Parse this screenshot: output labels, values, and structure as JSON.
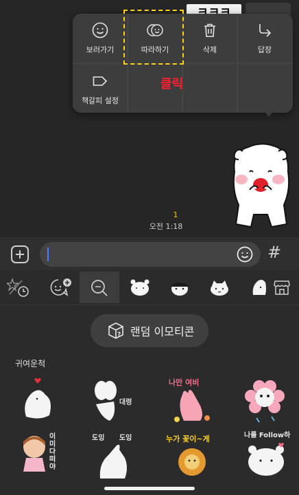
{
  "chat": {
    "peek_text": "ㅋㅋㅋ",
    "read_count": "1",
    "time": "오전 1:18"
  },
  "menu": {
    "items": [
      {
        "label": "보러가기",
        "icon": "smiley-icon"
      },
      {
        "label": "따라하기",
        "icon": "double-smiley-icon"
      },
      {
        "label": "삭제",
        "icon": "trash-icon"
      },
      {
        "label": "답장",
        "icon": "reply-arrow-icon"
      },
      {
        "label": "책갈피 설정",
        "icon": "bookmark-tag-icon"
      }
    ],
    "annotation": "클릭",
    "highlight_color": "#ffd21a",
    "annotation_color": "#ff1e2d"
  },
  "input": {
    "value": "",
    "placeholder": ""
  },
  "tabs": [
    "recent-icon",
    "emoticon-plus-icon",
    "search-icon",
    "bear-sticker-icon",
    "mask-sticker-icon",
    "cat-sticker-icon",
    "ghost-sticker-icon",
    "store-icon"
  ],
  "panel": {
    "random_button": "랜덤 이모티콘",
    "set_title": "귀여운척",
    "stickers": [
      {
        "text": ""
      },
      {
        "text": "대령"
      },
      {
        "text": "나만 여비"
      },
      {
        "text": ""
      },
      {
        "text": "이미 다 떠야"
      },
      {
        "text": "도잉 도잉"
      },
      {
        "text": "누가 꽃이~게"
      },
      {
        "text": "나를 Follow하"
      }
    ]
  },
  "accent": "#f2c400"
}
